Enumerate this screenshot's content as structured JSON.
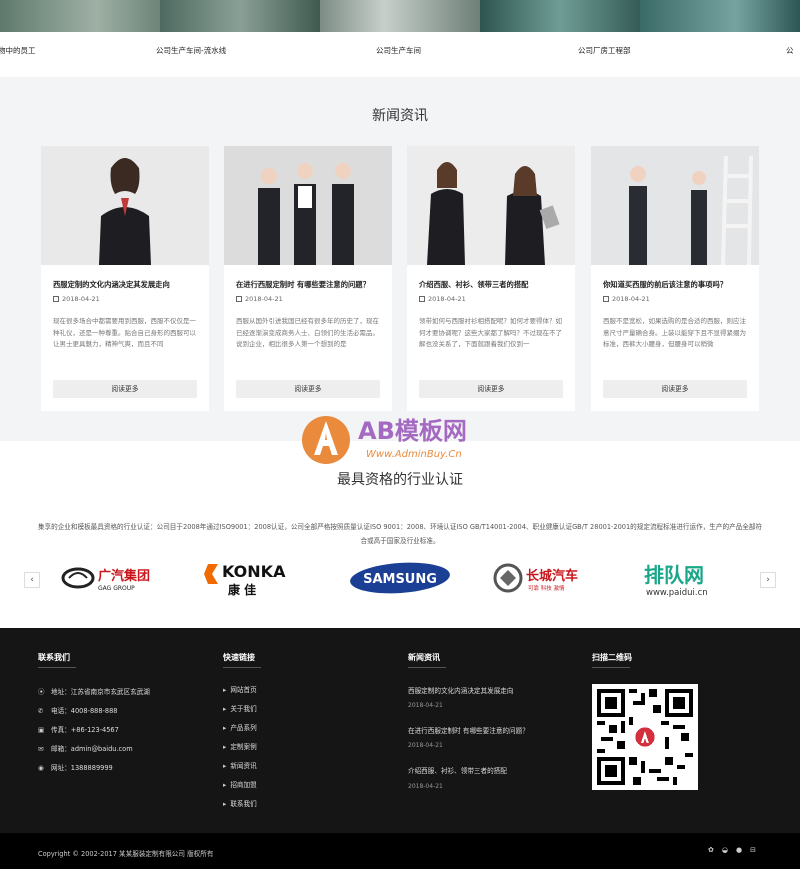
{
  "gallery": {
    "captions": [
      "物中的员工",
      "公司生产车间-流水线",
      "公司生产车间",
      "公司厂房工程部",
      "公"
    ]
  },
  "news": {
    "title": "新闻资讯",
    "cards": [
      {
        "title": "西服定制的文化内涵决定其发展走向",
        "date": "2018-04-21",
        "excerpt": "现在很多场合中都需要用到西服，西服不仅仅是一种礼仪，还是一种尊重。贴合自己身形的西服可以让男士更具魅力，精神气爽，而且不同",
        "more": "阅读更多"
      },
      {
        "title": "在进行西服定制时 有哪些要注意的问题？",
        "date": "2018-04-21",
        "excerpt": "西服从国外引进我国已经有很多年的历史了，现在已经逐渐演变成商务人士、白领们的生活必需品。说到企业，相比很多人第一个想到的是",
        "more": "阅读更多"
      },
      {
        "title": "介绍西服、衬衫、领带三者的搭配",
        "date": "2018-04-21",
        "excerpt": "领带如何与西服衬衫相搭配呢？如何才要得体？如何才要协调呢？这些大家都了解吗？不过现在不了解也没关系了，下面就跟着我们仅到一",
        "more": "阅读更多"
      },
      {
        "title": "你知道买西服的前后该注意的事项吗？",
        "date": "2018-04-21",
        "excerpt": "西服不是宽松，如果选购的是合适的西服，则应注意尺寸严量确合身。上装以能穿下且不显得紧绷为标准，西裤大小腰身，但腰身可以稍微",
        "more": "阅读更多"
      }
    ]
  },
  "watermark": {
    "brand": "AB模板网",
    "url": "Www.AdminBuy.Cn"
  },
  "cert": {
    "title": "最具资格的行业认证",
    "desc": "集享的企业和模板最具资格的行业认证：公司目于2008年通过ISO9001：2008认证，公司全部严格按照质量认证ISO 9001：2008、环境认证ISO GB/T14001-2004、职业健康认证GB/T 28001-2001的规定流程标准进行运作，生产的产品全部符合或高于国家及行业标准。",
    "prev": "‹",
    "next": "›",
    "logos": [
      {
        "name": "广汽集团",
        "sub": "GAG GROUP"
      },
      {
        "name": "KONKA",
        "sub": "康 佳"
      },
      {
        "name": "SAMSUNG"
      },
      {
        "name": "长城汽车",
        "sub": "可靠 科技 激情"
      },
      {
        "name": "排队网",
        "sub": "www.paidui.cn"
      }
    ]
  },
  "footer": {
    "contact": {
      "title": "联系我们",
      "items": [
        {
          "icon": "map-marker-icon",
          "glyph": "⦿",
          "text": "地址：江苏省南京市玄武区玄武湖"
        },
        {
          "icon": "phone-icon",
          "glyph": "✆",
          "text": "电话：4008-888-888"
        },
        {
          "icon": "print-icon",
          "glyph": "▣",
          "text": "传真：+86-123-4567"
        },
        {
          "icon": "mail-icon",
          "glyph": "✉",
          "text": "邮箱：admin@baidu.com"
        },
        {
          "icon": "globe-icon",
          "glyph": "◉",
          "text": "网址：1388889999"
        }
      ]
    },
    "links": {
      "title": "快速链接",
      "items": [
        "网站首页",
        "关于我们",
        "产品系列",
        "定制案例",
        "新闻资讯",
        "招商加盟",
        "联系我们"
      ]
    },
    "news": {
      "title": "新闻资讯",
      "items": [
        {
          "title": "西服定制的文化内涵决定其发展走向",
          "date": "2018-04-21"
        },
        {
          "title": "在进行西服定制时 有哪些要注意的问题？",
          "date": "2018-04-21"
        },
        {
          "title": "介绍西服、衬衫、领带三者的搭配",
          "date": "2018-04-21"
        }
      ]
    },
    "qr": {
      "title": "扫描二维码"
    }
  },
  "bottom": {
    "copyright": "Copyright © 2002-2017 某某服装定制有限公司 版权所有",
    "icons": [
      "wechat-icon",
      "weibo-icon",
      "qq-icon",
      "shop-icon"
    ]
  }
}
